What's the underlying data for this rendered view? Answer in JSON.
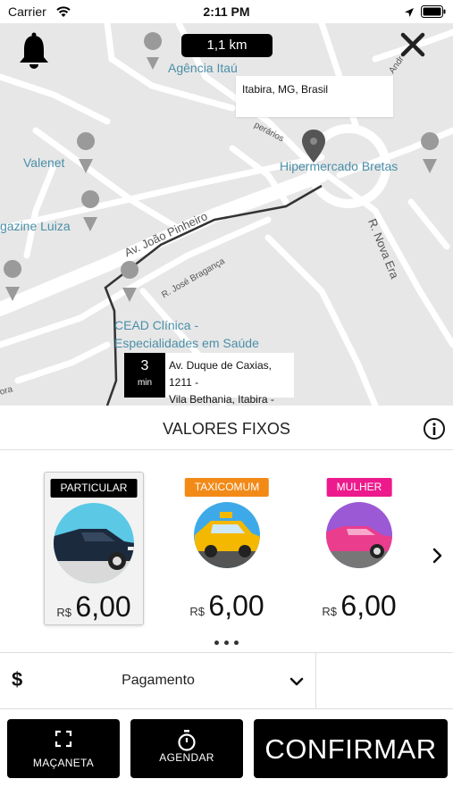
{
  "status_bar": {
    "carrier": "Carrier",
    "time": "2:11 PM"
  },
  "map": {
    "distance": "1,1 km",
    "destination": "Itabira, MG, Brasil",
    "origin_minutes": "3",
    "origin_minutes_unit": "min",
    "origin_address_line1": "Av. Duque de Caxias, 1211 -",
    "origin_address_line2": "Vila Bethania, Itabira - MG,",
    "places": {
      "agencia": "Agência Itaú",
      "valenet": "Valenet",
      "hipermercado": "Hipermercado Bretas",
      "magazine": "gazine Luiza",
      "cead_line1": "CEAD Clínica -",
      "cead_line2": "Especialidades em Saúde"
    },
    "roads": {
      "joao_pinheiro": "Av. João Pinheiro",
      "jose_braganca": "R. José Bragança",
      "nova_era": "R. Nova Era",
      "perarios": "perários",
      "andr": "Andr",
      "ora": "ora"
    }
  },
  "fixed_values": {
    "title": "VALORES FIXOS"
  },
  "categories": [
    {
      "name": "PARTICULAR",
      "currency": "R$",
      "price": "6,00",
      "badge_color": "#000000",
      "car_color": "#1c2a3e",
      "bg_color": "#5bc8e6"
    },
    {
      "name": "TAXICOMUM",
      "currency": "R$",
      "price": "6,00",
      "badge_color": "#f28a17",
      "car_color": "#f5b800",
      "bg_color": "#3ea9e8"
    },
    {
      "name": "MULHER",
      "currency": "R$",
      "price": "6,00",
      "badge_color": "#ec1a8c",
      "car_color": "#ea3d8e",
      "bg_color": "#9b59d6"
    }
  ],
  "payment": {
    "label": "Pagamento",
    "currency_symbol": "$"
  },
  "buttons": {
    "macaneta": "MAÇANETA",
    "agendar": "AGENDAR",
    "confirmar": "CONFIRMAR"
  },
  "icons": [
    "wifi-icon",
    "location-arrow-icon",
    "battery-icon",
    "bell-icon",
    "close-icon",
    "map-pin-icon",
    "info-icon",
    "chevron-right-icon",
    "chevron-down-icon",
    "expand-icon",
    "stopwatch-icon"
  ]
}
